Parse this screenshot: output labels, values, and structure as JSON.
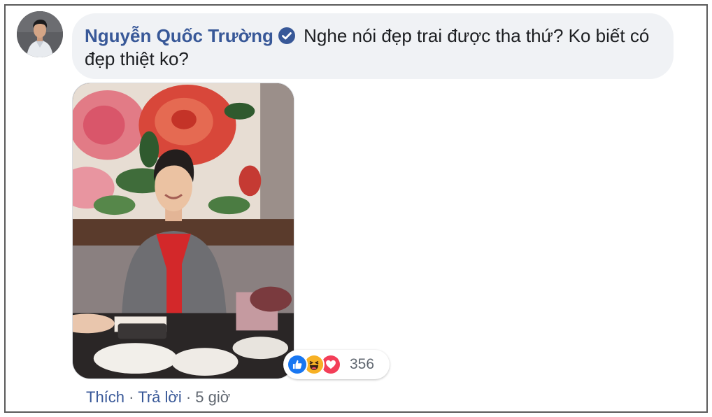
{
  "comment": {
    "author": "Nguyễn Quốc Trường",
    "text": "Nghe nói đẹp trai được tha thứ? Ko biết có đẹp thiệt ko?",
    "verified_icon": "verified-badge-icon"
  },
  "reactions": {
    "icons": [
      "like-icon",
      "haha-icon",
      "love-icon"
    ],
    "count": "356"
  },
  "actions": {
    "like_label": "Thích",
    "separator": "·",
    "reply_label": "Trả lời",
    "time": "5 giờ"
  },
  "colors": {
    "author": "#385898",
    "bubble": "#f0f2f5",
    "like": "#1877f2",
    "love": "#f33e58",
    "haha": "#f7b125"
  }
}
